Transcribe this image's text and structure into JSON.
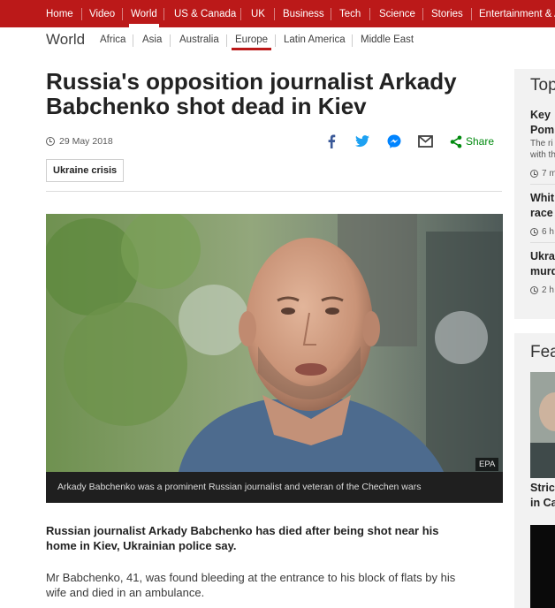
{
  "top_nav": {
    "items": [
      "Home",
      "Video",
      "World",
      "US & Canada",
      "UK",
      "Business",
      "Tech",
      "Science",
      "Stories",
      "Entertainment & Arts"
    ],
    "active": "World",
    "color": "#bb1919"
  },
  "section_nav": {
    "section": "World",
    "items": [
      "Africa",
      "Asia",
      "Australia",
      "Europe",
      "Latin America",
      "Middle East"
    ],
    "active": "Europe"
  },
  "article": {
    "headline": "Russia's opposition journalist Arkady Babchenko shot dead in Kiev",
    "date": "29 May 2018",
    "share_label": "Share",
    "share_icons": [
      "facebook-icon",
      "twitter-icon",
      "messenger-icon",
      "email-icon",
      "share-icon"
    ],
    "tag": "Ukraine crisis",
    "image_credit": "EPA",
    "image_caption": "Arkady Babchenko was a prominent Russian journalist and veteran of the Chechen wars",
    "intro": "Russian journalist Arkady Babchenko has died after being shot near his home in Kiev, Ukrainian police say.",
    "paragraph": "Mr Babchenko, 41, was found bleeding at the entrance to his block of flats by his wife and died in an ambulance."
  },
  "sidebar": {
    "top_title": "Top",
    "stories": [
      {
        "head1": "Key",
        "head2": "Pom",
        "sum1": "The ri",
        "sum2": "with th",
        "time": "7 m"
      },
      {
        "head1": "Whit",
        "head2": "race",
        "time": "6 h"
      },
      {
        "head1": "Ukra",
        "head2": "murd",
        "time": "2 h"
      }
    ],
    "features_title": "Fea",
    "feature_head1": "Stric",
    "feature_head2": "in Ca"
  }
}
